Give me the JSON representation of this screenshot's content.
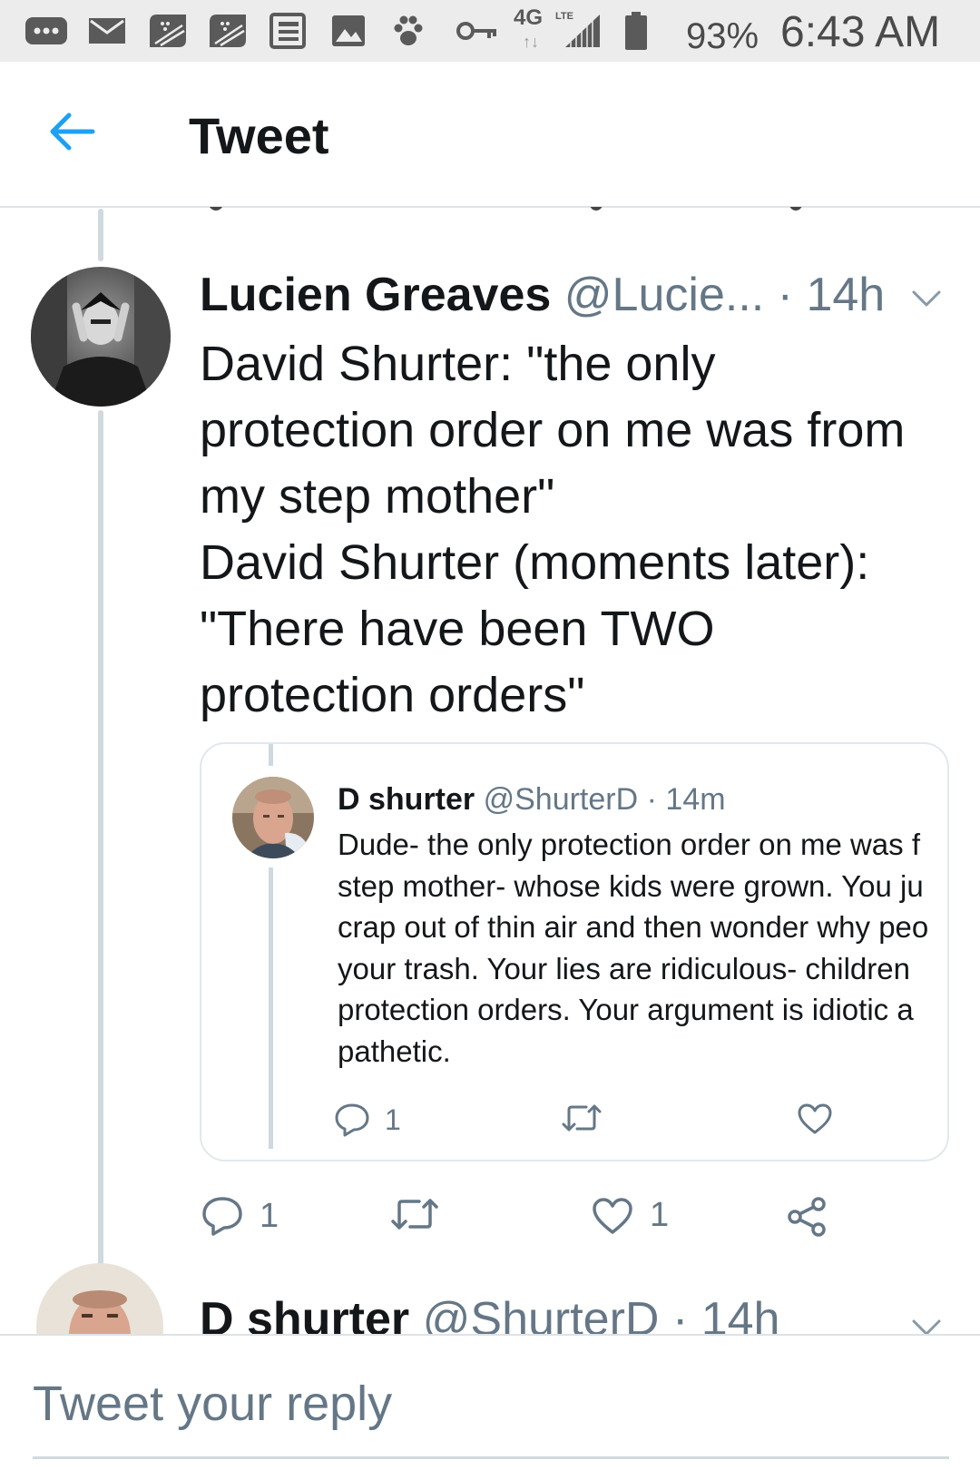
{
  "status_bar": {
    "network": "4G",
    "network_sub": "LTE",
    "battery": "93%",
    "time": "6:43 AM",
    "icons": [
      "more-icon",
      "mail-icon",
      "blackberry-icon",
      "blackberry-icon",
      "news-icon",
      "image-icon",
      "paw-icon",
      "key-icon",
      "signal-icon",
      "battery-icon"
    ]
  },
  "header": {
    "title": "Tweet",
    "back_icon": "back-arrow-icon"
  },
  "tweet": {
    "name": "Lucien Greaves",
    "handle": "@Lucie...",
    "dot": "·",
    "time": "14h",
    "text": "David Shurter: \"the only\nprotection order on me was from\nmy step mother\"\nDavid Shurter (moments later):\n\"There have been TWO\nprotection orders\"",
    "reply_count": "1",
    "retweet_count": "",
    "like_count": "1"
  },
  "quoted": {
    "name": "D shurter",
    "handle": "@ShurterD",
    "dot": "·",
    "time": "14m",
    "lines": [
      "Dude- the only protection order on me was f",
      "step mother- whose kids were grown. You ju",
      "crap out of thin air and then wonder why peo",
      "your trash. Your lies are ridiculous- children",
      "protection orders. Your argument is idiotic a",
      "pathetic."
    ],
    "reply_count": "1"
  },
  "next_tweet": {
    "name": "D shurter",
    "handle": "@ShurterD",
    "dot": "·",
    "time": "14h"
  },
  "reply": {
    "placeholder": "Tweet your reply"
  },
  "colors": {
    "accent": "#1da1f2",
    "secondary_text": "#657786",
    "thread_line": "#cfd9de"
  }
}
